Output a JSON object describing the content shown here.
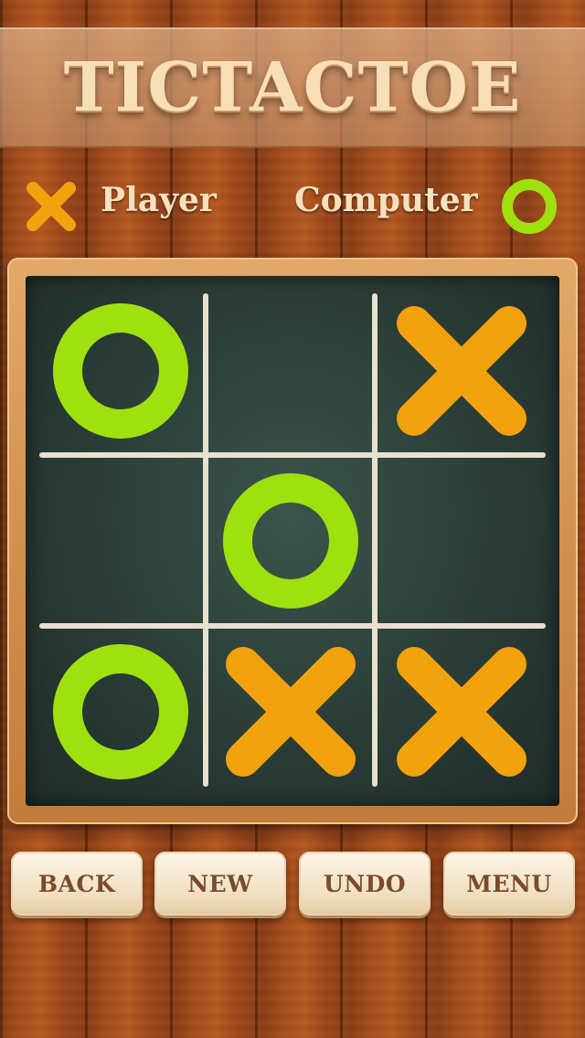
{
  "app": {
    "title": "TICTACTOE"
  },
  "players": {
    "player_label": "Player",
    "player_icon": "x-icon",
    "computer_label": "Computer",
    "computer_icon": "o-icon"
  },
  "colors": {
    "x_color": "#f2a20c",
    "o_color": "#9ee10f",
    "chalk": "#f2ead6",
    "board": "#2f433d",
    "frame": "#d89552"
  },
  "board": {
    "cells": [
      "O",
      "",
      "X",
      "",
      "O",
      "",
      "O",
      "X",
      "X"
    ]
  },
  "buttons": {
    "back": "BACK",
    "new": "NEW",
    "undo": "UNDO",
    "menu": "MENU"
  }
}
